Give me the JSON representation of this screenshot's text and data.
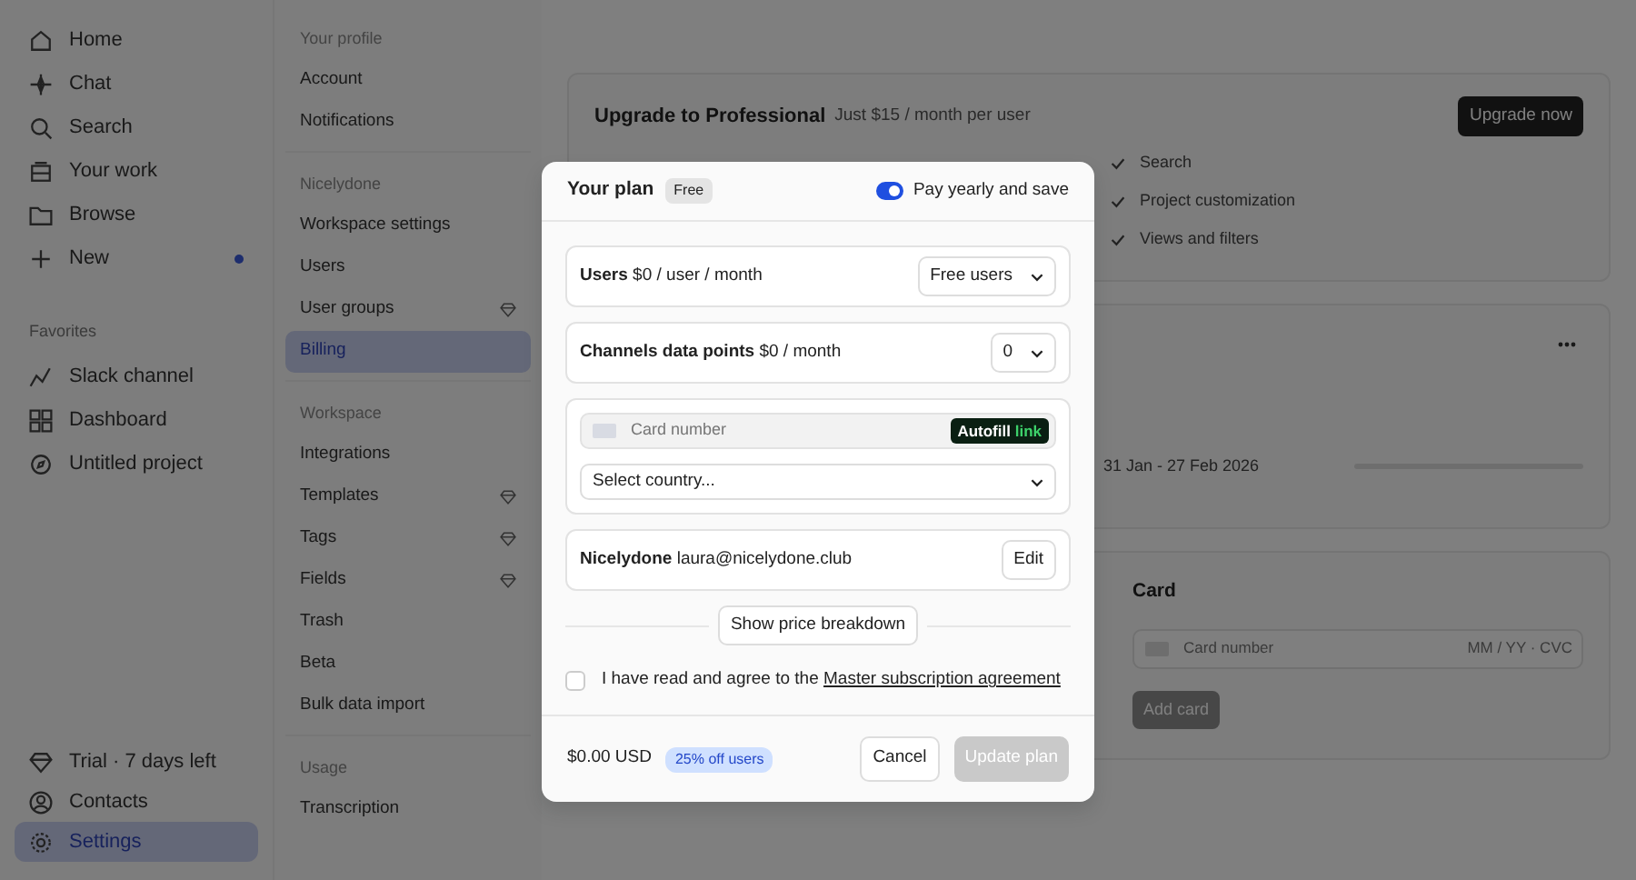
{
  "sidebar": {
    "items": [
      {
        "label": "Home",
        "selected": false
      },
      {
        "label": "Chat",
        "selected": false
      },
      {
        "label": "Search",
        "selected": false
      },
      {
        "label": "Your work",
        "selected": false
      },
      {
        "label": "Browse",
        "selected": false
      },
      {
        "label": "New",
        "selected": false,
        "unread": true
      }
    ],
    "favorites_title": "Favorites",
    "favorites": [
      {
        "label": "Slack channel",
        "selected": false
      },
      {
        "label": "Dashboard",
        "selected": false
      },
      {
        "label": "Untitled project",
        "selected": false
      }
    ],
    "bottom": [
      {
        "label": "Trial · 7 days left",
        "selected": false
      },
      {
        "label": "Contacts",
        "selected": false
      },
      {
        "label": "Settings",
        "selected": true
      }
    ]
  },
  "settings_nav": [
    {
      "title": "Your profile",
      "items": [
        {
          "label": "Account",
          "selected": false,
          "premium": false
        },
        {
          "label": "Notifications",
          "selected": false,
          "premium": false
        }
      ]
    },
    {
      "title": "Nicelydone",
      "items": [
        {
          "label": "Workspace settings",
          "selected": false,
          "premium": false
        },
        {
          "label": "Users",
          "selected": false,
          "premium": false
        },
        {
          "label": "User groups",
          "selected": false,
          "premium": true
        },
        {
          "label": "Billing",
          "selected": true,
          "premium": false
        }
      ]
    },
    {
      "title": "Workspace",
      "items": [
        {
          "label": "Integrations",
          "selected": false,
          "premium": false
        },
        {
          "label": "Templates",
          "selected": false,
          "premium": true
        },
        {
          "label": "Tags",
          "selected": false,
          "premium": true
        },
        {
          "label": "Fields",
          "selected": false,
          "premium": true
        },
        {
          "label": "Trash",
          "selected": false,
          "premium": false
        },
        {
          "label": "Beta",
          "selected": false,
          "premium": false
        },
        {
          "label": "Bulk data import",
          "selected": false,
          "premium": false
        }
      ]
    },
    {
      "title": "Usage",
      "items": [
        {
          "label": "Transcription",
          "selected": false,
          "premium": false
        }
      ]
    }
  ],
  "upgrade": {
    "title": "Upgrade to Professional",
    "subtitle": "Just $15 / month per user",
    "button": "Upgrade now",
    "features_right": [
      "Search",
      "Project customization",
      "Views and filters"
    ]
  },
  "usage": {
    "period": "31 Jan - 27 Feb 2026",
    "level": 0
  },
  "card": {
    "title": "Card",
    "placeholder": "Card number",
    "expiry_placeholder": "MM / YY · CVC",
    "button": "Add card"
  },
  "modal": {
    "title": "Your plan",
    "plan_badge": "Free",
    "toggle": {
      "label": "Pay yearly and save",
      "on": true
    },
    "rows": [
      {
        "text": "**Users** $0 / user / month",
        "select": "Free users"
      },
      {
        "text": "**Channels data points** $0 / month",
        "select": "0"
      }
    ],
    "card_placeholder": "Card number",
    "autofill": "Autofill",
    "autofill_brand": "link",
    "country_placeholder": "Select country...",
    "contact": "**Nicelydone** laura@nicelydone.club",
    "edit": "Edit",
    "breakdown": "Show price breakdown",
    "agree": {
      "text": "I have read and agree to the",
      "link": "Master subscription agreement",
      "checked": false
    },
    "total": "$0.00 USD",
    "discount": "25% off users",
    "cancel": "Cancel",
    "submit": "Update plan",
    "submit_disabled": true
  }
}
